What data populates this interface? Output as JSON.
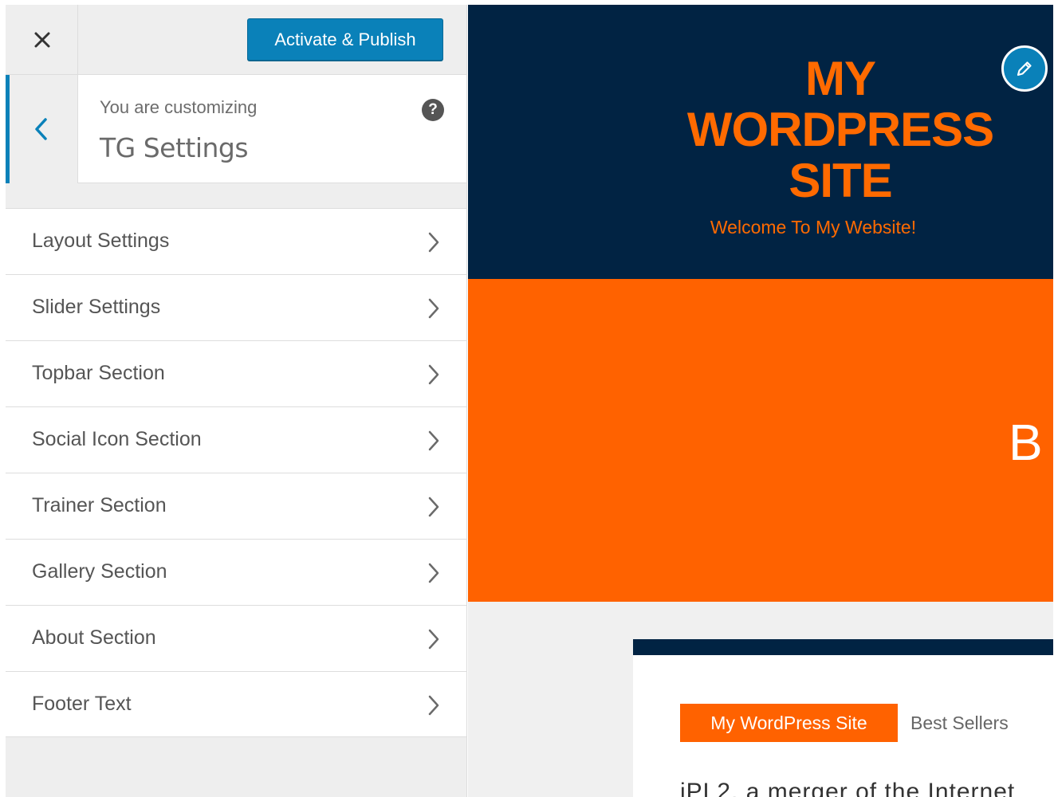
{
  "customizer": {
    "close_icon": "close-icon",
    "publish_label": "Activate & Publish",
    "back_icon": "chevron-left-icon",
    "customizing_label": "You are customizing",
    "section_title": "TG Settings",
    "help_icon_glyph": "?",
    "menu_items": [
      {
        "label": "Layout Settings"
      },
      {
        "label": "Slider Settings"
      },
      {
        "label": "Topbar Section"
      },
      {
        "label": "Social Icon Section"
      },
      {
        "label": "Trainer Section"
      },
      {
        "label": "Gallery Section"
      },
      {
        "label": "About Section"
      },
      {
        "label": "Footer Text"
      }
    ]
  },
  "preview": {
    "site_title_lines": [
      "MY",
      "WORDPRESS",
      "SITE"
    ],
    "tagline": "Welcome To My Website!",
    "edit_icon": "pencil-icon",
    "hero_letter": "B",
    "tabs": {
      "active": "My WordPress Site",
      "other": "Best Sellers"
    },
    "content_text": "iPL2, a merger of the Internet"
  },
  "colors": {
    "accent_blue": "#0a81b9",
    "header_navy": "#012343",
    "brand_orange": "#ff6200"
  }
}
